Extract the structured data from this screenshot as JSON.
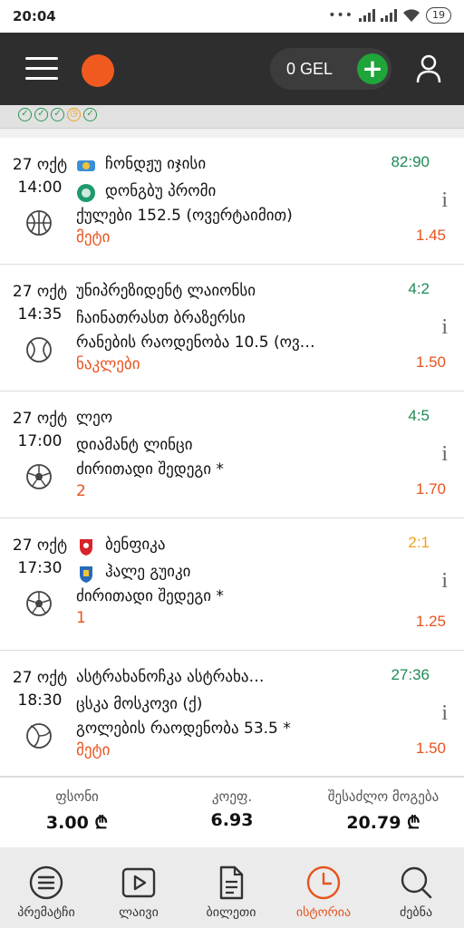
{
  "status_bar": {
    "time": "20:04",
    "battery": "19"
  },
  "header": {
    "balance": "0 GEL"
  },
  "bets": [
    {
      "date": "27 ოქტ",
      "time": "14:00",
      "sport": "basketball",
      "team1": "ჩონდჟუ იჯისი",
      "team2": "დონგბუ პრომი",
      "market": "ქულები 152.5 (ოვერტაიმით)",
      "pick": "მეტი",
      "score": "82:90",
      "odds": "1.45",
      "info": "i"
    },
    {
      "date": "27 ოქტ",
      "time": "14:35",
      "sport": "baseball",
      "team1": "უნიპრეზიდენტ ლაიონსი",
      "team2": "ჩაინათრასთ ბრაზერსი",
      "market": "რანების რაოდენობა 10.5 (ოვ…",
      "pick": "ნაკლები",
      "score": "4:2",
      "odds": "1.50",
      "info": "i"
    },
    {
      "date": "27 ოქტ",
      "time": "17:00",
      "sport": "football",
      "team1": "ლეო",
      "team2": "დიამანტ ლინცი",
      "market": "ძირითადი შედეგი *",
      "pick": "2",
      "score": "4:5",
      "odds": "1.70",
      "info": "i"
    },
    {
      "date": "27 ოქტ",
      "time": "17:30",
      "sport": "football",
      "team1": "ბენფიკა",
      "team2": "ჰალე გუიკი",
      "market": "ძირითადი შედეგი *",
      "pick": "1",
      "score": "2:1",
      "odds": "1.25",
      "info": "i"
    },
    {
      "date": "27 ოქტ",
      "time": "18:30",
      "sport": "volleyball",
      "team1": "ასტრახანოჩკა ასტრახა…",
      "team2": "ცსკა მოსკოვი (ქ)",
      "market": "გოლების რაოდენობა 53.5 *",
      "pick": "მეტი",
      "score": "27:36",
      "odds": "1.50",
      "info": "i"
    }
  ],
  "summary": {
    "stake_label": "ფსონი",
    "stake_value": "3.00 ₾",
    "odds_label": "კოეფ.",
    "odds_value": "6.93",
    "win_label": "შესაძლო მოგება",
    "win_value": "20.79 ₾"
  },
  "nav": [
    {
      "label": "პრემატჩი",
      "icon": "list-circle-icon"
    },
    {
      "label": "ლაივი",
      "icon": "play-icon"
    },
    {
      "label": "ბილეთი",
      "icon": "ticket-document-icon"
    },
    {
      "label": "ისტორია",
      "icon": "clock-icon"
    },
    {
      "label": "ძებნა",
      "icon": "search-icon"
    }
  ],
  "colors": {
    "accent": "#e8531e",
    "score_won": "#1d8a55",
    "score_pending": "#efa21b",
    "appbar": "#2e2e2e",
    "add_button": "#1fa53a"
  }
}
